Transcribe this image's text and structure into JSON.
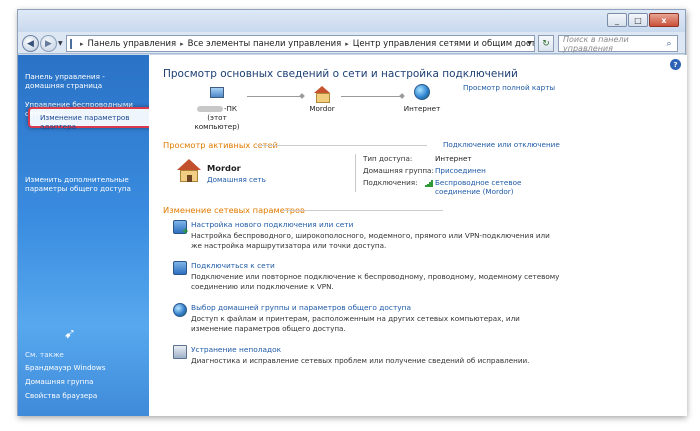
{
  "window": {
    "minimize": "_",
    "maximize": "□",
    "close": "x"
  },
  "nav": {
    "back": "◀",
    "forward": "▶",
    "history": "▼"
  },
  "address": {
    "crumbs": [
      "Панель управления",
      "Все элементы панели управления",
      "Центр управления сетями и общим доступом"
    ],
    "separator": "▸"
  },
  "search": {
    "placeholder": "Поиск в панели управления"
  },
  "sidebar": {
    "items": [
      "Панель управления - домашняя страница",
      "Управление беспроводными сетями",
      "Изменение параметров адаптера",
      "Изменить дополнительные параметры общего доступа"
    ],
    "see_also_title": "См. также",
    "see_also": [
      "Брандмауэр Windows",
      "Домашняя группа",
      "Свойства браузера"
    ]
  },
  "main": {
    "title": "Просмотр основных сведений о сети и настройка подключений",
    "view_full_map": "Просмотр полной карты",
    "nodes": {
      "pc_suffix": "-ПК",
      "pc_caption": "(этот компьютер)",
      "network": "Mordor",
      "internet": "Интернет"
    },
    "active_networks": {
      "heading": "Просмотр активных сетей",
      "connect_disconnect": "Подключение или отключение",
      "network_name": "Mordor",
      "network_type": "Домашняя сеть",
      "access_type_label": "Тип доступа:",
      "access_type_value": "Интернет",
      "homegroup_label": "Домашняя группа:",
      "homegroup_value": "Присоединен",
      "connections_label": "Подключения:",
      "connections_value": "Беспроводное сетевое соединение (Mordor)"
    },
    "change_settings": {
      "heading": "Изменение сетевых параметров",
      "tasks": [
        {
          "title": "Настройка нового подключения или сети",
          "desc": "Настройка беспроводного, широкополосного, модемного, прямого или VPN-подключения или же настройка маршрутизатора или точки доступа."
        },
        {
          "title": "Подключиться к сети",
          "desc": "Подключение или повторное подключение к беспроводному, проводному, модемному сетевому соединению или подключение к VPN."
        },
        {
          "title": "Выбор домашней группы и параметров общего доступа",
          "desc": "Доступ к файлам и принтерам, расположенным на других сетевых компьютерах, или изменение параметров общего доступа."
        },
        {
          "title": "Устранение неполадок",
          "desc": "Диагностика и исправление сетевых проблем или получение сведений об исправлении."
        }
      ]
    }
  },
  "colors": {
    "accent_link": "#1f5aa6",
    "section_heading": "#e07a00",
    "highlight_border": "#d8394b",
    "sidebar_top": "#2a72c6"
  },
  "icons": {
    "help": "?",
    "refresh": "↻",
    "search": "⌕",
    "bird": "➹"
  }
}
